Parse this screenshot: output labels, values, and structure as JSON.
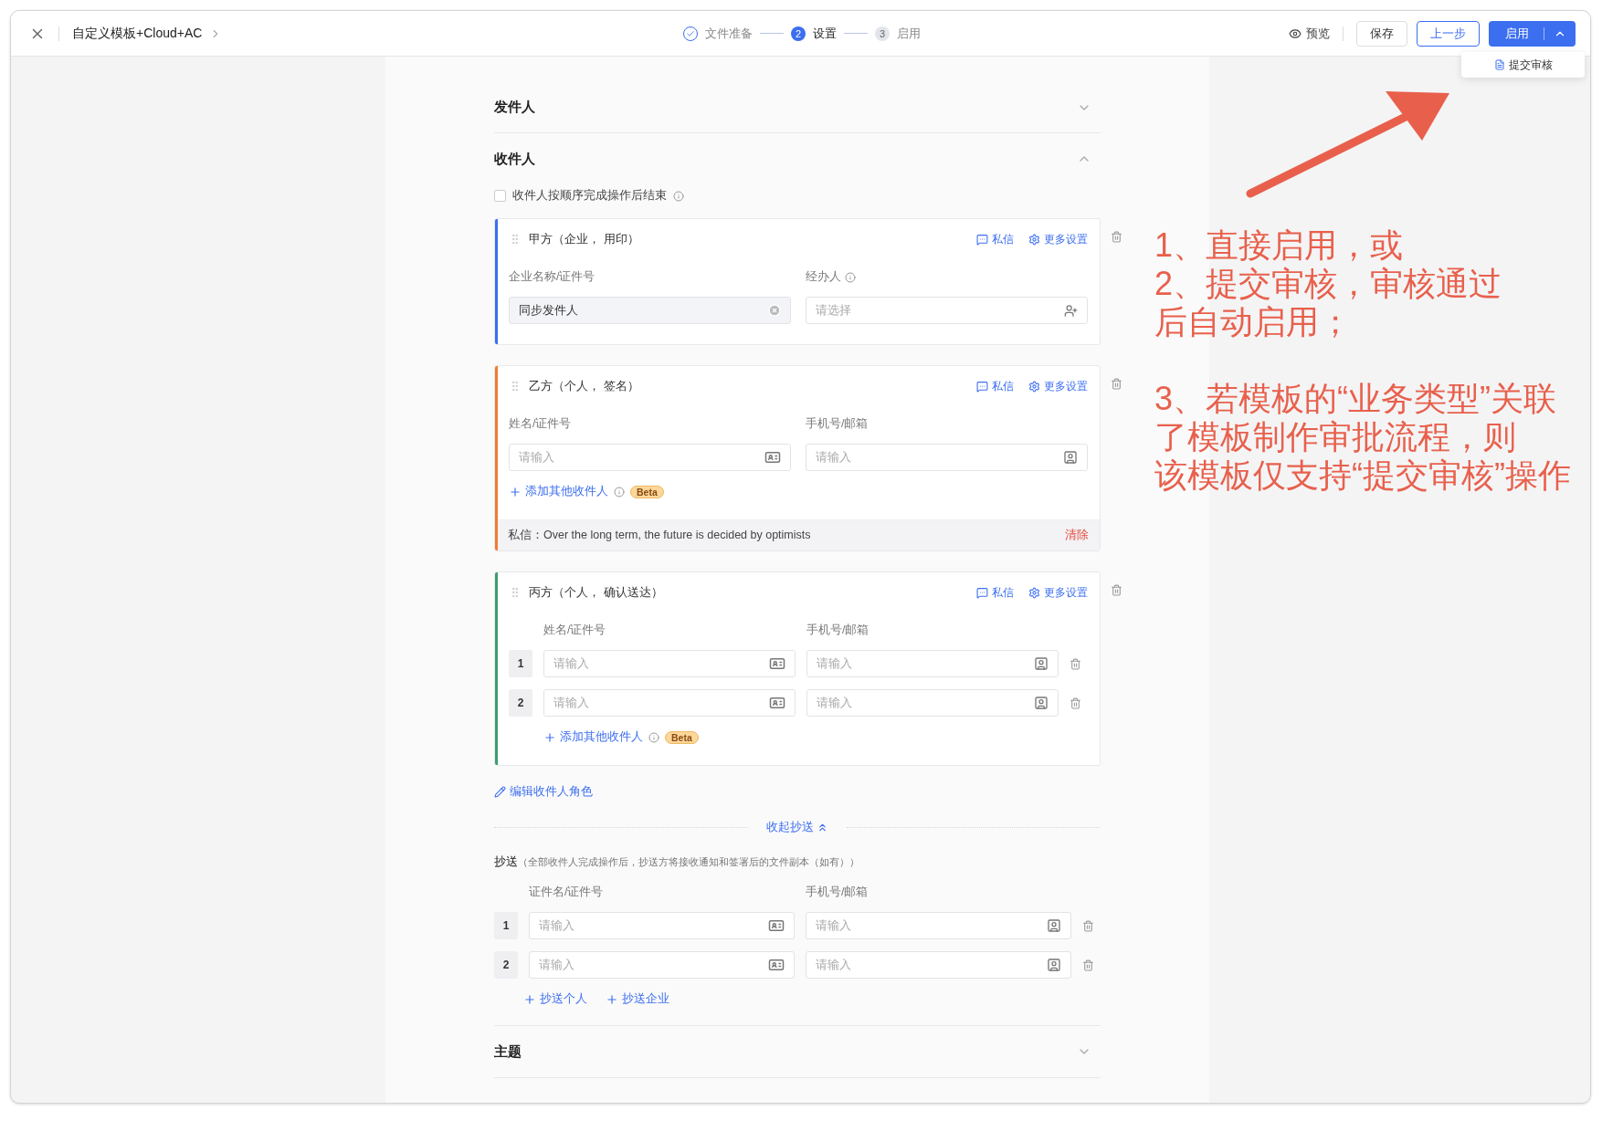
{
  "header": {
    "title": "自定义模板+Cloud+AC",
    "steps": [
      {
        "label": "文件准备",
        "completed": true,
        "selected": false
      },
      {
        "number": "2",
        "label": "设置",
        "completed": false,
        "selected": true
      },
      {
        "number": "3",
        "label": "启用",
        "completed": false,
        "selected": false
      }
    ],
    "preview": "预览",
    "save": "保存",
    "back": "上一步",
    "enable": "启用",
    "menu_item": "提交审核"
  },
  "sender_section": {
    "title": "发件人",
    "expanded": false
  },
  "recipient_section": {
    "title": "收件人",
    "expanded": true,
    "sequential": {
      "label": "收件人按顺序完成操作后结束",
      "checked": false
    },
    "parties": [
      {
        "kind": "company",
        "title": "甲方（企业， 用印）",
        "color": "#3c6ef0",
        "message": "私信",
        "settings": "更多设置",
        "fields": [
          {
            "label": "企业名称/证件号",
            "value": "同步发件人"
          },
          {
            "label": "经办人",
            "info": true,
            "placeholder": "请选择"
          }
        ]
      },
      {
        "kind": "single",
        "title": "乙方（个人， 签名）",
        "color": "#f07c30",
        "message": "私信",
        "settings": "更多设置",
        "fields": [
          {
            "label": "姓名/证件号",
            "placeholder": "请输入"
          },
          {
            "label": "手机号/邮箱",
            "placeholder": "请输入"
          }
        ],
        "add_other": "添加其他收件人",
        "badge": "Beta",
        "private_message": {
          "label": "私信：",
          "text": "Over the long term, the future is decided by optimists",
          "clear": "清除"
        }
      },
      {
        "kind": "multi",
        "title": "丙方（个人， 确认送达）",
        "color": "#3a9e6e",
        "message": "私信",
        "settings": "更多设置",
        "columns": [
          "姓名/证件号",
          "手机号/邮箱"
        ],
        "rows": [
          {
            "index": "1",
            "fields": [
              {
                "placeholder": "请输入"
              },
              {
                "placeholder": "请输入"
              }
            ]
          },
          {
            "index": "2",
            "fields": [
              {
                "placeholder": "请输入"
              },
              {
                "placeholder": "请输入"
              }
            ]
          }
        ],
        "add_other": "添加其他收件人",
        "badge": "Beta"
      }
    ],
    "edit_roles": "编辑收件人角色"
  },
  "cc": {
    "toggle": "收起抄送",
    "title": "抄送",
    "note": "（全部收件人完成操作后，抄送方将接收通知和签署后的文件副本（如有））",
    "columns": [
      "证件名/证件号",
      "手机号/邮箱"
    ],
    "rows": [
      {
        "index": "1",
        "fields": [
          {
            "placeholder": "请输入"
          },
          {
            "placeholder": "请输入"
          }
        ]
      },
      {
        "index": "2",
        "fields": [
          {
            "placeholder": "请输入"
          },
          {
            "placeholder": "请输入"
          }
        ]
      }
    ],
    "add_buttons": [
      "抄送个人",
      "抄送企业"
    ]
  },
  "subject_section": {
    "title": "主题",
    "expanded": false
  },
  "annotation": {
    "paragraphs": [
      {
        "lines": [
          "1、直接启用，或",
          "2、提交审核，审核通过",
          "后自动启用；"
        ]
      },
      {
        "lines": [
          "3、若模板的“业务类型”关联",
          "了模板制作审批流程，则",
          "该模板仅支持“提交审核”操作"
        ]
      }
    ]
  }
}
